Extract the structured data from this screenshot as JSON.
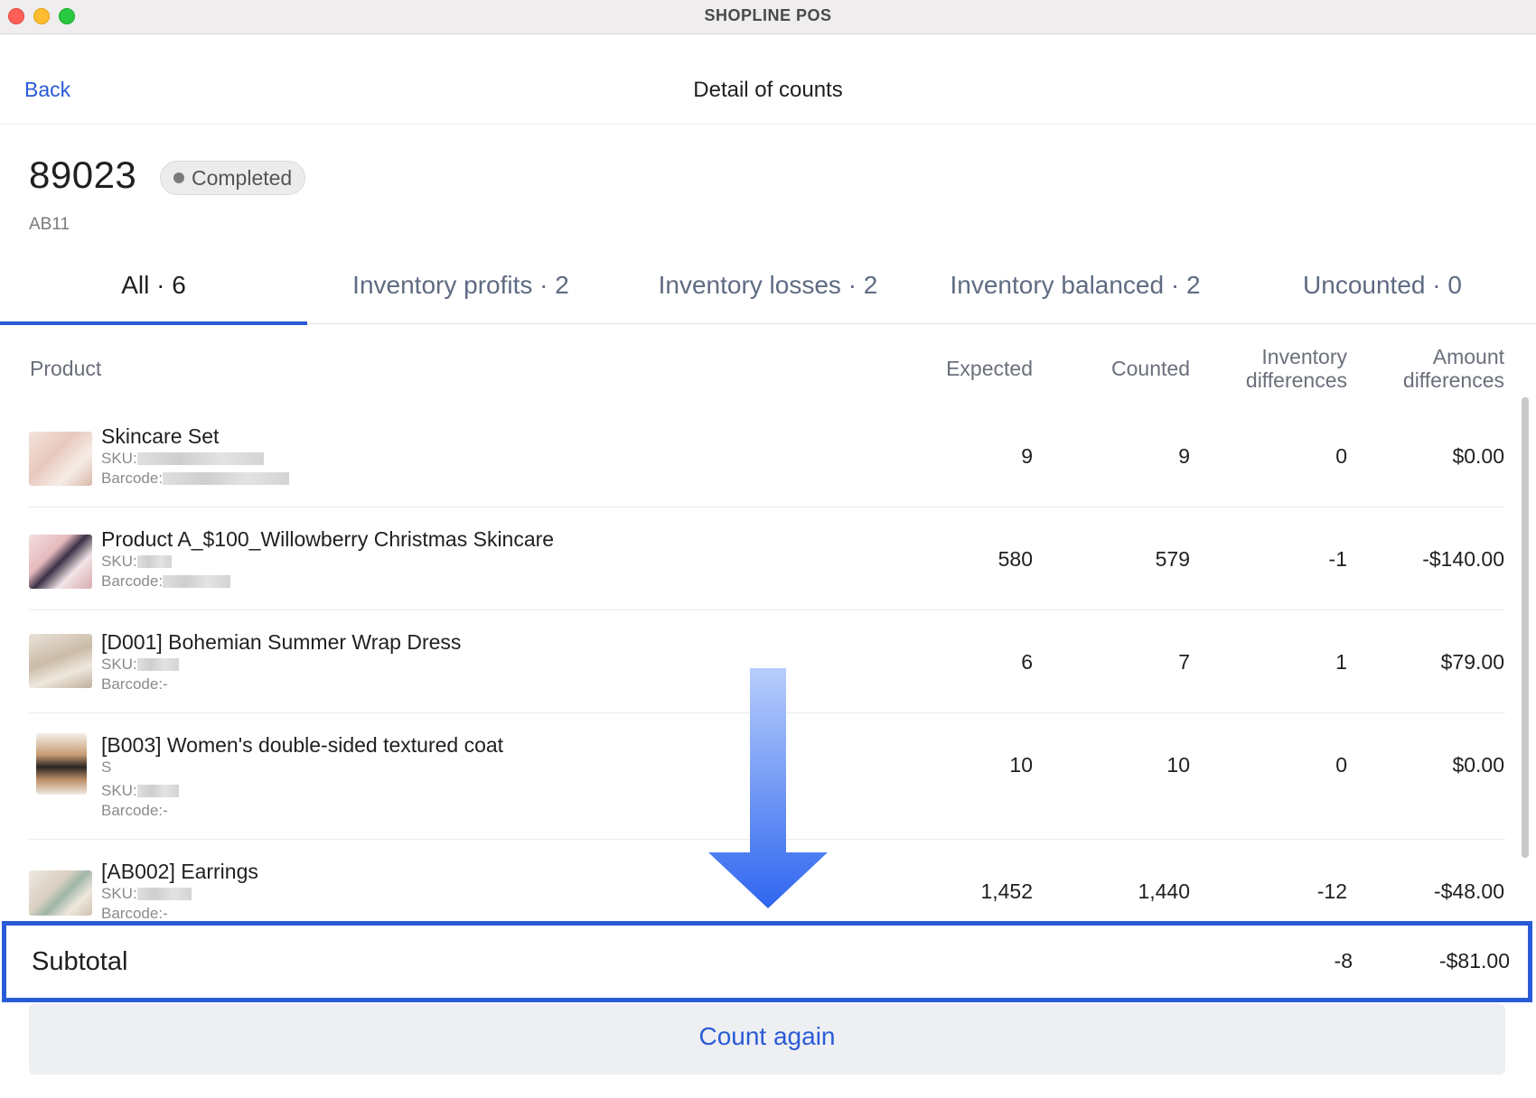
{
  "window": {
    "title": "SHOPLINE POS"
  },
  "header": {
    "back_label": "Back",
    "title": "Detail of counts"
  },
  "record": {
    "id": "89023",
    "status": "Completed",
    "code": "AB11"
  },
  "tabs": [
    {
      "label": "All · 6"
    },
    {
      "label": "Inventory profits · 2"
    },
    {
      "label": "Inventory losses · 2"
    },
    {
      "label": "Inventory balanced · 2"
    },
    {
      "label": "Uncounted · 0"
    }
  ],
  "table": {
    "headers": {
      "product": "Product",
      "expected": "Expected",
      "counted": "Counted",
      "inventory_diff_1": "Inventory",
      "inventory_diff_2": "differences",
      "amount_diff_1": "Amount",
      "amount_diff_2": "differences"
    },
    "rows": [
      {
        "name": "Skincare Set",
        "variant": "",
        "sku_label": "SKU:",
        "barcode_label": "Barcode:",
        "barcode_value": "",
        "expected": "9",
        "counted": "9",
        "inventory_diff": "0",
        "amount_diff": "$0.00"
      },
      {
        "name": "Product A_$100_Willowberry Christmas Skincare",
        "variant": "",
        "sku_label": "SKU:",
        "barcode_label": "Barcode:",
        "barcode_value": "",
        "expected": "580",
        "counted": "579",
        "inventory_diff": "-1",
        "amount_diff": "-$140.00"
      },
      {
        "name": "[D001] Bohemian Summer Wrap Dress",
        "variant": "",
        "sku_label": "SKU:",
        "barcode_label": "Barcode:",
        "barcode_value": "-",
        "expected": "6",
        "counted": "7",
        "inventory_diff": "1",
        "amount_diff": "$79.00"
      },
      {
        "name": "[B003] Women's double-sided textured coat",
        "variant": "S",
        "sku_label": "SKU:",
        "barcode_label": "Barcode:",
        "barcode_value": "-",
        "expected": "10",
        "counted": "10",
        "inventory_diff": "0",
        "amount_diff": "$0.00"
      },
      {
        "name": "[AB002] Earrings",
        "variant": "",
        "sku_label": "SKU:",
        "barcode_label": "Barcode:",
        "barcode_value": "-",
        "expected": "1,452",
        "counted": "1,440",
        "inventory_diff": "-12",
        "amount_diff": "-$48.00"
      }
    ]
  },
  "subtotal": {
    "label": "Subtotal",
    "inventory_diff": "-8",
    "amount_diff": "-$81.00"
  },
  "actions": {
    "count_again": "Count again"
  },
  "colors": {
    "accent": "#2a5bd7",
    "status_badge_bg": "#ececec",
    "muted_text": "#6a6f7a"
  }
}
